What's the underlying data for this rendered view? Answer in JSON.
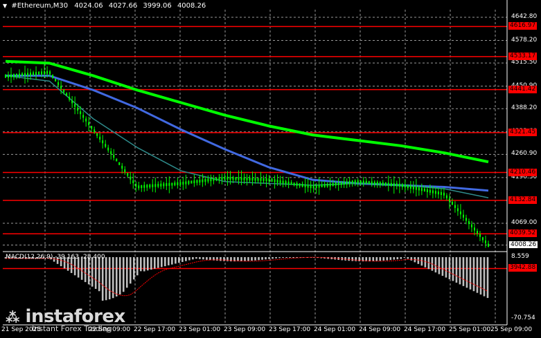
{
  "header": {
    "symbol": "#Ethereum,M30",
    "open": "4024.06",
    "high": "4027.66",
    "low": "3999.06",
    "close": "4008.26"
  },
  "price_axis": {
    "ticks": [
      "4642.80",
      "4578.20",
      "4515.50",
      "4450.90",
      "4388.20",
      "4323.60",
      "4260.90",
      "4196.30",
      "4069.00",
      "4008.26"
    ],
    "tick_values": [
      4642.8,
      4578.2,
      4515.5,
      4450.9,
      4388.2,
      4323.6,
      4260.9,
      4196.3,
      4069.0,
      4008.26
    ],
    "current_price": "4008.26"
  },
  "levels": [
    {
      "label": "4616.97",
      "value": 4616.97
    },
    {
      "label": "4533.17",
      "value": 4533.17
    },
    {
      "label": "4441.42",
      "value": 4441.42
    },
    {
      "label": "4321.45",
      "value": 4321.45
    },
    {
      "label": "4210.46",
      "value": 4210.46
    },
    {
      "label": "4132.84",
      "value": 4132.84
    },
    {
      "label": "4039.52",
      "value": 4039.52
    },
    {
      "label": "3942.88",
      "value": 3942.88
    }
  ],
  "macd": {
    "label": "MACD(12,26,9) -39.163 -28.400",
    "axis_top": "8.559",
    "axis_bottom": "-70.754"
  },
  "time_axis": [
    "21 Sep 2025",
    "22 Sep 09:00",
    "22 Sep 17:00",
    "23 Sep 01:00",
    "23 Sep 09:00",
    "23 Sep 17:00",
    "24 Sep 01:00",
    "24 Sep 09:00",
    "24 Sep 17:00",
    "25 Sep 01:00",
    "25 Sep 09:00"
  ],
  "watermark": {
    "brand": "instaforex",
    "tagline": "Instant Forex Trading"
  },
  "colors": {
    "background": "#000000",
    "level_line": "#ff0000",
    "ma_green": "#00ff00",
    "ma_blue": "#4169e1",
    "ma_teal": "#2e8b8b",
    "candles": "#00ff00",
    "macd_hist": "#c0c0c0",
    "macd_signal": "#ff0000"
  },
  "chart_data": {
    "type": "line",
    "title": "#Ethereum,M30",
    "x": [
      "21 Sep",
      "22 Sep 01:00",
      "22 Sep 09:00",
      "22 Sep 17:00",
      "23 Sep 01:00",
      "23 Sep 09:00",
      "23 Sep 17:00",
      "24 Sep 01:00",
      "24 Sep 09:00",
      "24 Sep 17:00",
      "25 Sep 01:00",
      "25 Sep 09:00"
    ],
    "series": [
      {
        "values": [
          4478,
          4490,
          4330,
          4170,
          4180,
          4195,
          4190,
          4170,
          4185,
          4175,
          4150,
          4008
        ]
      },
      {
        "values": [
          4520,
          4515,
          4480,
          4440,
          4405,
          4370,
          4340,
          4315,
          4300,
          4285,
          4265,
          4240
        ]
      },
      {
        "values": [
          4480,
          4480,
          4440,
          4390,
          4330,
          4275,
          4225,
          4190,
          4180,
          4175,
          4170,
          4160
        ]
      },
      {
        "values": [
          4480,
          4465,
          4360,
          4280,
          4215,
          4185,
          4180,
          4175,
          4180,
          4175,
          4165,
          4140
        ]
      }
    ],
    "ylim": [
      3942.88,
      4642.8
    ]
  }
}
